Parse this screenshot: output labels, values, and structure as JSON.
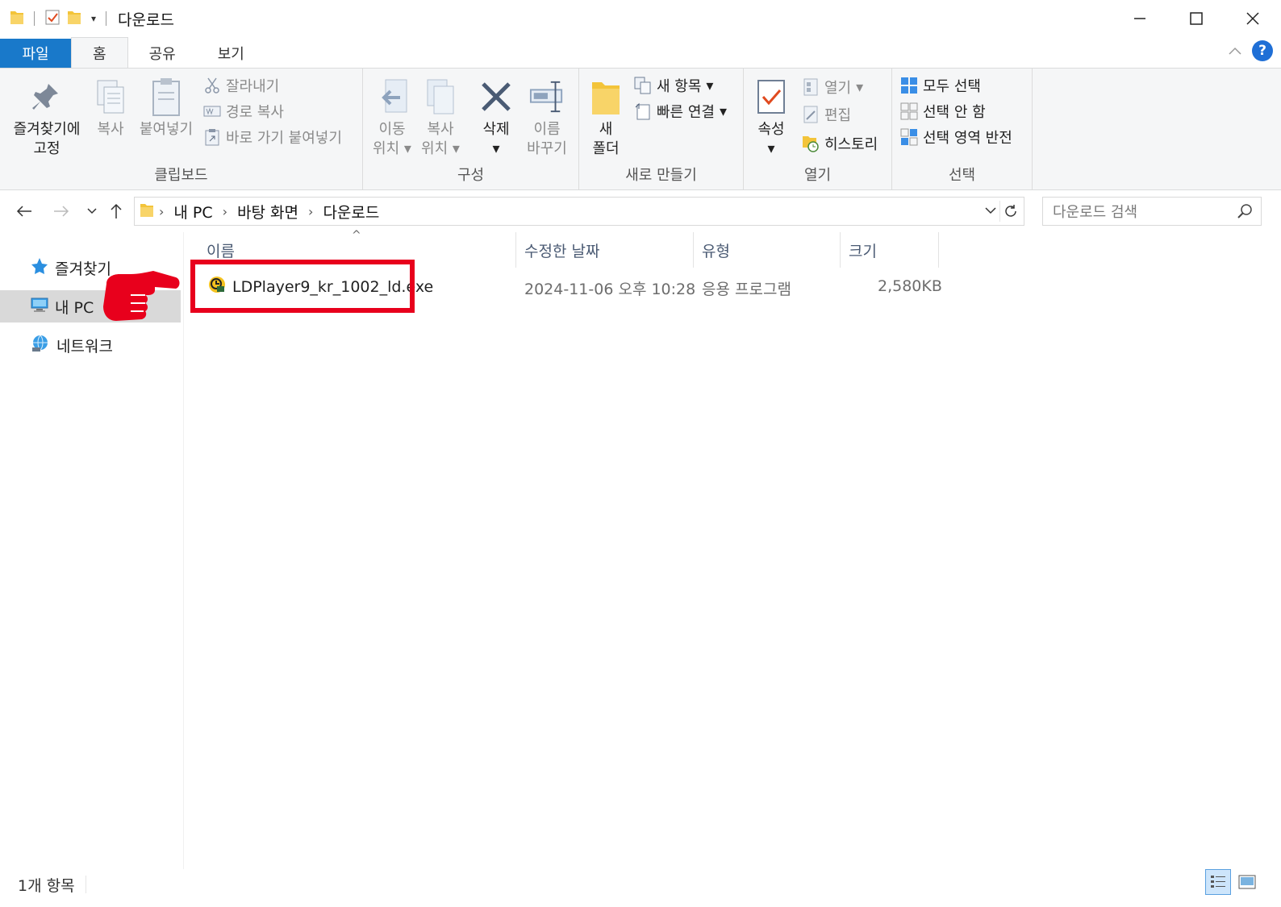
{
  "window": {
    "title": "다운로드"
  },
  "tabs": [
    {
      "label": "파일"
    },
    {
      "label": "홈"
    },
    {
      "label": "공유"
    },
    {
      "label": "보기"
    }
  ],
  "help_label": "?",
  "ribbon": {
    "clipboard": {
      "label": "클립보드",
      "pin_l1": "즐겨찾기에",
      "pin_l2": "고정",
      "copy": "복사",
      "paste": "붙여넣기",
      "cut": "잘라내기",
      "copy_path": "경로 복사",
      "paste_shortcut": "바로 가기 붙여넣기"
    },
    "organize": {
      "label": "구성",
      "move_l1": "이동",
      "move_l2": "위치",
      "copyto_l1": "복사",
      "copyto_l2": "위치",
      "delete": "삭제",
      "rename_l1": "이름",
      "rename_l2": "바꾸기"
    },
    "new": {
      "label": "새로 만들기",
      "folder_l1": "새",
      "folder_l2": "폴더",
      "new_item": "새 항목",
      "easy_access": "빠른 연결"
    },
    "open": {
      "label": "열기",
      "properties": "속성",
      "open": "열기",
      "edit": "편집",
      "history": "히스토리"
    },
    "select": {
      "label": "선택",
      "select_all": "모두 선택",
      "select_none": "선택 안 함",
      "invert": "선택 영역 반전"
    }
  },
  "address": {
    "crumbs": [
      "내 PC",
      "바탕 화면",
      "다운로드"
    ],
    "search_placeholder": "다운로드 검색"
  },
  "nav": {
    "items": [
      {
        "label": "즐겨찾기"
      },
      {
        "label": "내 PC"
      },
      {
        "label": "네트워크"
      }
    ]
  },
  "columns": {
    "name": "이름",
    "date": "수정한 날짜",
    "type": "유형",
    "size": "크기"
  },
  "files": [
    {
      "name": "LDPlayer9_kr_1002_ld.exe",
      "date": "2024-11-06 오후 10:28",
      "type": "응용 프로그램",
      "size": "2,580KB"
    }
  ],
  "status": {
    "count": "1개 항목"
  },
  "colors": {
    "accent": "#1979ca",
    "highlight": "#e8001c"
  }
}
